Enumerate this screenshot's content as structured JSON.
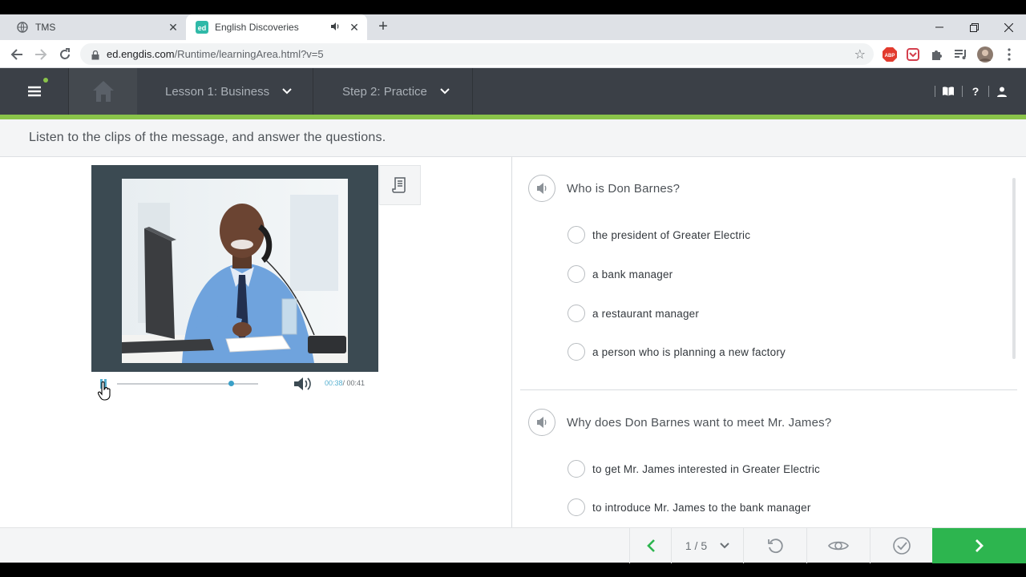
{
  "browser": {
    "tabs": [
      {
        "title": "TMS",
        "active": false
      },
      {
        "title": "English Discoveries",
        "active": true
      }
    ],
    "url_domain": "ed.engdis.com",
    "url_path": "/Runtime/learningArea.html?v=5"
  },
  "header": {
    "lesson_label": "Lesson 1: Business",
    "step_label": "Step 2: Practice"
  },
  "instruction": "Listen to the clips of the message, and answer the questions.",
  "player": {
    "current_time": "00:38",
    "total_time": "/ 00:41",
    "progress_fraction": 0.93
  },
  "questions": [
    {
      "text": "Who is Don Barnes?",
      "options": [
        "the president of Greater Electric",
        "a bank manager",
        "a restaurant manager",
        "a person who is planning a new factory"
      ]
    },
    {
      "text": "Why does Don Barnes want to meet Mr. James?",
      "options": [
        "to get Mr. James interested in Greater Electric",
        "to introduce Mr. James to the bank manager"
      ]
    }
  ],
  "footer": {
    "pager": "1 / 5"
  },
  "colors": {
    "accent_green": "#2db54f",
    "header_bg": "#3b4047",
    "progress_blue": "#3aa0c8"
  }
}
